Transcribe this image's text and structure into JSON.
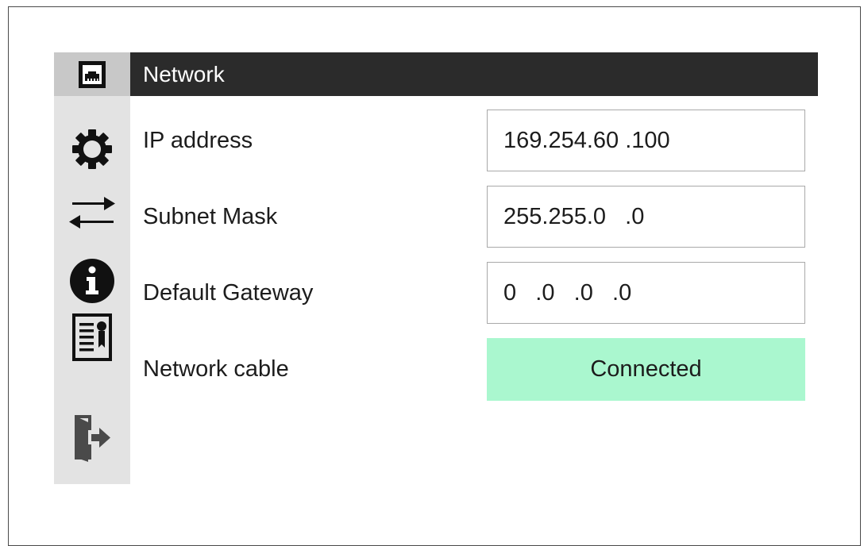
{
  "header": {
    "title": "Network"
  },
  "sidebar": {
    "items": [
      {
        "name": "network",
        "icon": "ethernet-port-icon",
        "active": true
      },
      {
        "name": "settings",
        "icon": "gear-icon",
        "active": false
      },
      {
        "name": "transfer",
        "icon": "transfer-arrows-icon",
        "active": false
      },
      {
        "name": "info",
        "icon": "info-icon",
        "active": false
      },
      {
        "name": "certificate",
        "icon": "certificate-document-icon",
        "active": false
      },
      {
        "name": "logout",
        "icon": "exit-door-icon",
        "active": false
      }
    ]
  },
  "network": {
    "ip_address": {
      "label": "IP address",
      "value": "169.254.60 .100"
    },
    "subnet_mask": {
      "label": "Subnet Mask",
      "value": "255.255.0   .0"
    },
    "default_gateway": {
      "label": "Default Gateway",
      "value": "0   .0   .0   .0"
    },
    "network_cable": {
      "label": "Network cable",
      "value": "Connected",
      "status_color": "#aaf7cf"
    }
  },
  "colors": {
    "header_bg": "#2b2b2b",
    "sidebar_bg": "#e3e3e3",
    "sidebar_active_bg": "#c8c8c8",
    "connected_bg": "#aaf7cf"
  }
}
